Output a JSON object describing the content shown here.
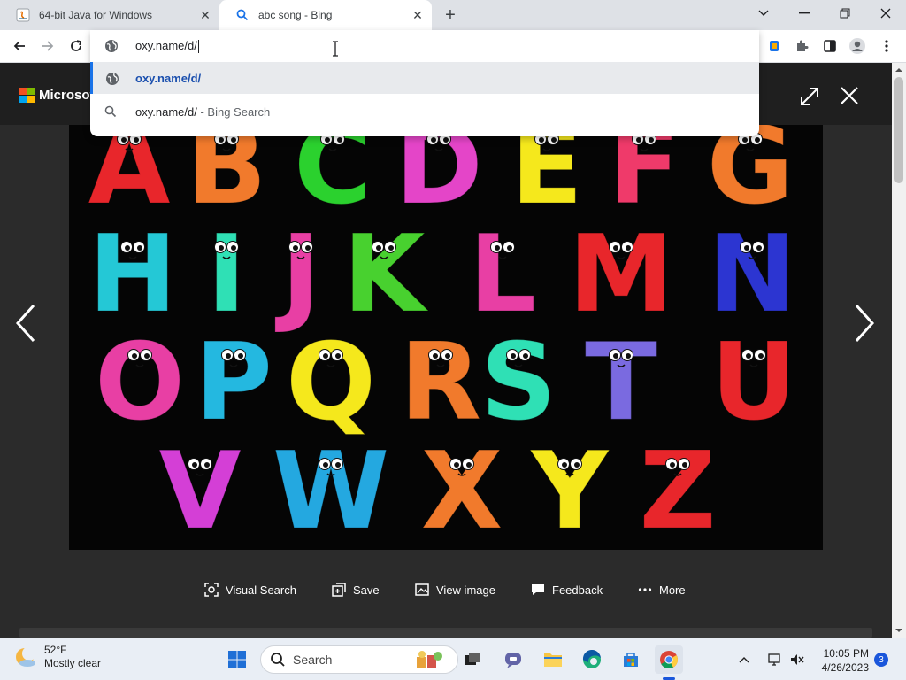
{
  "browser": {
    "tabs": [
      {
        "title": "64-bit Java for Windows",
        "active": false,
        "icon": "java-icon"
      },
      {
        "title": "abc song - Bing",
        "active": true,
        "icon": "search-icon"
      }
    ],
    "omnibox": {
      "value": "oxy.name/d/",
      "suggestions": [
        {
          "text": "oxy.name/d/",
          "sub": "",
          "icon": "globe-icon",
          "selected": true
        },
        {
          "text": "oxy.name/d/",
          "sub": " - Bing Search",
          "icon": "search-icon",
          "selected": false
        }
      ]
    }
  },
  "page": {
    "logo": "Microsoft",
    "image_alt": "Colorful cartoon alphabet letters with eyes on black background",
    "letters": [
      "A",
      "B",
      "C",
      "D",
      "E",
      "F",
      "G",
      "H",
      "I",
      "J",
      "K",
      "L",
      "M",
      "N",
      "O",
      "P",
      "Q",
      "R",
      "S",
      "T",
      "U",
      "V",
      "W",
      "X",
      "Y",
      "Z"
    ],
    "actions": [
      {
        "label": "Visual Search",
        "icon": "visual-search-icon"
      },
      {
        "label": "Save",
        "icon": "save-icon"
      },
      {
        "label": "View image",
        "icon": "view-image-icon"
      },
      {
        "label": "Feedback",
        "icon": "feedback-icon"
      },
      {
        "label": "More",
        "icon": "more-icon"
      }
    ]
  },
  "taskbar": {
    "weather": {
      "temp": "52°F",
      "condition": "Mostly clear"
    },
    "search_label": "Search",
    "time": "10:05 PM",
    "date": "4/26/2023",
    "notification_count": "3"
  },
  "colors": {
    "accent": "#1a73e8",
    "letters": [
      "#e8262b",
      "#f17a2c",
      "#2bd12e",
      "#e445c8",
      "#f5e81c",
      "#ef3a6a",
      "#f17a2c",
      "#24c8d6",
      "#2fe0b5",
      "#e83fa4",
      "#48d12f",
      "#e83fa4",
      "#e8262b",
      "#2c35d1",
      "#e83fa4",
      "#24b8e0",
      "#f5e81c",
      "#f17a2c",
      "#2fe0b5",
      "#7a6ae0",
      "#e8262b",
      "#d43fd6",
      "#24a8e0",
      "#f17a2c",
      "#f5e81c",
      "#e8262b"
    ]
  }
}
